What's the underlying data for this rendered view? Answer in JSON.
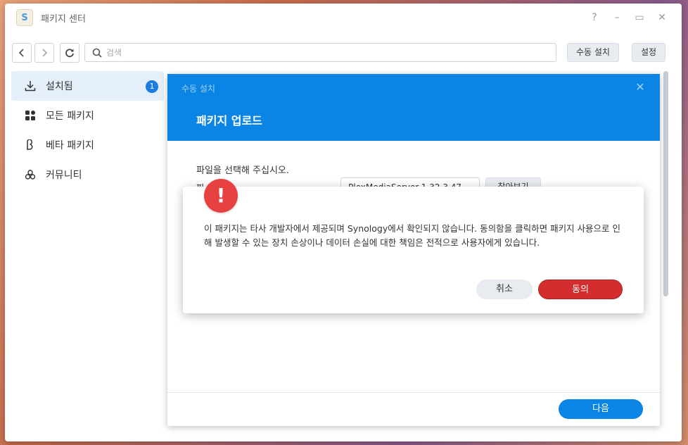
{
  "window": {
    "title": "패키지 센터",
    "app_icon_letter": "S"
  },
  "window_controls": {
    "help": "?",
    "minimize": "–",
    "maximize": "▭",
    "close": "✕"
  },
  "toolbar": {
    "search_placeholder": "검색",
    "manual_install_label": "수동 설치",
    "settings_label": "설정"
  },
  "sidebar": {
    "items": [
      {
        "label": "설치됨",
        "icon": "download-icon",
        "badge": "1",
        "active": true
      },
      {
        "label": "모든 패키지",
        "icon": "grid-icon",
        "active": false
      },
      {
        "label": "베타 패키지",
        "icon": "beta-icon",
        "active": false
      },
      {
        "label": "커뮤니티",
        "icon": "community-icon",
        "active": false
      }
    ]
  },
  "dialog": {
    "small_title": "수동 설치",
    "title": "패키지 업로드",
    "instruction": "파일을 선택해 주십시오.",
    "file_label": "파",
    "file_value": "PlexMediaServer-1.32.3.47",
    "browse_label": "찾아보기",
    "next_label": "다음"
  },
  "alert": {
    "icon": "!",
    "message": "이 패키지는 타사 개발자에서 제공되며 Synology에서 확인되지 않습니다. 동의함을 클릭하면 패키지 사용으로 인해 발생할 수 있는 장치 손상이나 데이터 손실에 대한 책임은 전적으로 사용자에게 있습니다.",
    "cancel_label": "취소",
    "agree_label": "동의"
  },
  "colors": {
    "accent": "#0a85e6",
    "danger": "#d42d2d",
    "sidebar_active": "#e5effa"
  }
}
